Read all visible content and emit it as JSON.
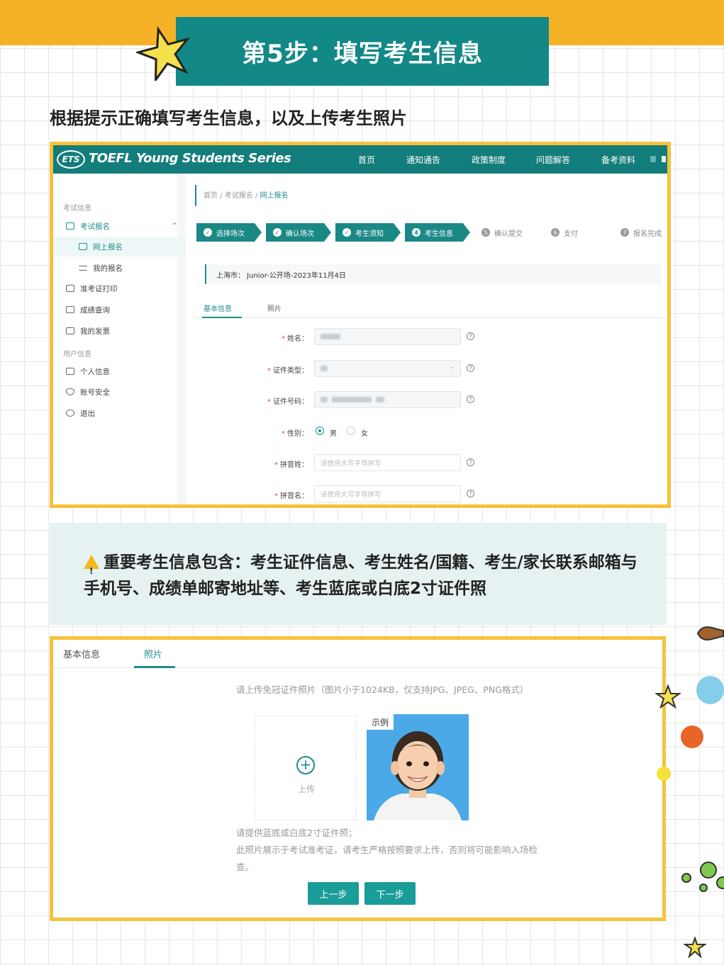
{
  "header": {
    "title": "第5步：填写考生信息",
    "subtitle": "根据提示正确填写考生信息，以及上传考生照片"
  },
  "shot1": {
    "logo": "ETS",
    "brand": "TOEFL Young Students Series",
    "nav": [
      "首页",
      "通知通告",
      "政策制度",
      "问题解答",
      "备考资料"
    ],
    "sidebar": {
      "exam_head": "考试信息",
      "items": [
        "考试报名",
        "网上报名",
        "我的报名",
        "准考证打印",
        "成绩查询",
        "我的发票"
      ],
      "user_head": "用户信息",
      "user_items": [
        "个人信息",
        "账号安全",
        "退出"
      ]
    },
    "breadcrumb": {
      "home": "首页",
      "sep": "/",
      "level2": "考试报名",
      "current": "网上报名"
    },
    "steps": [
      {
        "icon": "✓",
        "label": "选择场次"
      },
      {
        "icon": "✓",
        "label": "确认场次"
      },
      {
        "icon": "✓",
        "label": "考生须知"
      },
      {
        "icon": "4",
        "label": "考生信息"
      },
      {
        "icon": "5",
        "label": "确认提交"
      },
      {
        "icon": "6",
        "label": "支付"
      },
      {
        "icon": "7",
        "label": "报名完成"
      }
    ],
    "exam_info": "上海市：   Junior-公开场-2023年11月4日",
    "tabs": [
      "基本信息",
      "照片"
    ],
    "form": {
      "name_label": "姓名：",
      "id_type_label": "证件类型：",
      "id_no_label": "证件号码：",
      "gender_label": "性别：",
      "gender_male": "男",
      "gender_female": "女",
      "pinyin_last_label": "拼音姓：",
      "pinyin_first_label": "拼音名：",
      "pinyin_placeholder": "请使用大写字母拼写",
      "required_mark": "*",
      "help_mark": "?"
    }
  },
  "notice": {
    "warn_mark": "!",
    "text": "重要考生信息包含：考生证件信息、考生姓名/国籍、考生/家长联系邮箱与手机号、成绩单邮寄地址等、考生蓝底或白底2寸证件照"
  },
  "shot2": {
    "tabs": [
      "基本信息",
      "照片"
    ],
    "upload_hint": "请上传免冠证件照片（图片小于1024KB，仅支持JPG、JPEG、PNG格式）",
    "upload_plus": "+",
    "upload_label": "上传",
    "example_label": "示例",
    "note_line1": "请提供蓝底或白底2寸证件照；",
    "note_line2": "此照片展示于考试准考证，请考生严格按照要求上传，否则将可能影响入场检",
    "note_line3": "查。",
    "prev_button": "上一步",
    "next_button": "下一步"
  },
  "colors": {
    "teal": "#128887",
    "accent": "#f5c23a",
    "orange": "#f6b226"
  }
}
